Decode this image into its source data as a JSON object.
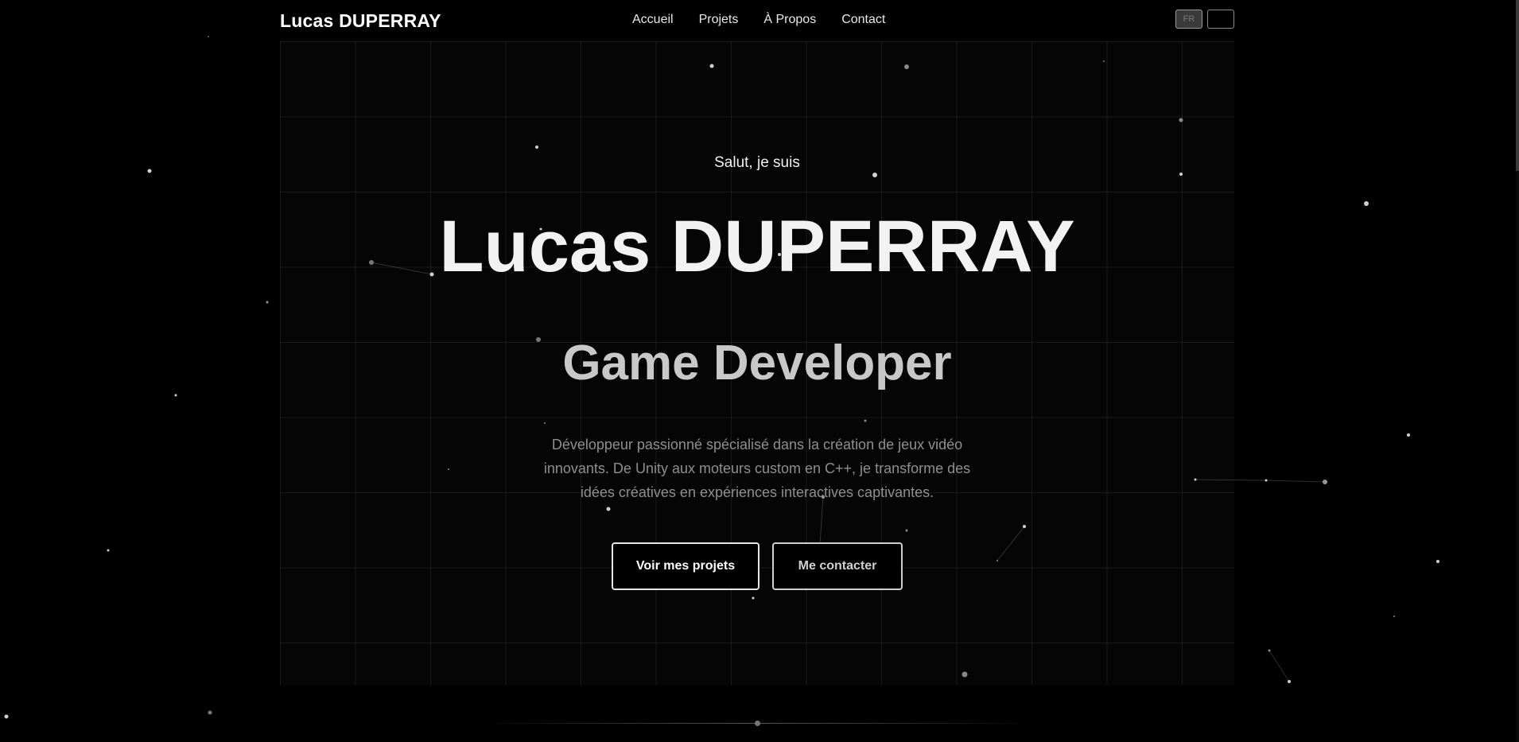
{
  "brand": {
    "logo_text": "Lucas DUPERRAY"
  },
  "nav": {
    "items": [
      {
        "label": "Accueil"
      },
      {
        "label": "Projets"
      },
      {
        "label": "À Propos"
      },
      {
        "label": "Contact"
      }
    ]
  },
  "language": {
    "options": [
      {
        "label": "FR",
        "active": true
      },
      {
        "label": "",
        "active": false
      }
    ]
  },
  "hero": {
    "greeting": "Salut, je suis",
    "name": "Lucas DUPERRAY",
    "role": "Game Developer",
    "description": "Développeur passionné spécialisé dans la création de jeux vidéo innovants. De Unity aux moteurs custom en C++, je transforme des idées créatives en expériences interactives captivantes.",
    "primary_button": "Voir mes projets",
    "secondary_button": "Me contacter"
  },
  "colors": {
    "background": "#000000",
    "text": "#ffffff",
    "muted_text": "#8f8f8f",
    "grid_line": "#1a1a1a"
  }
}
